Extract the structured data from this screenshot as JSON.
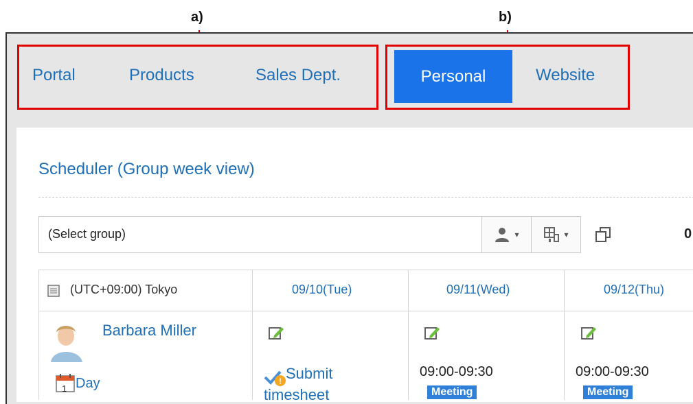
{
  "callouts": {
    "a": "a)",
    "b": "b)"
  },
  "tabs": {
    "left": [
      {
        "label": "Portal"
      },
      {
        "label": "Products"
      },
      {
        "label": "Sales Dept."
      }
    ],
    "right": [
      {
        "label": "Personal",
        "active": true
      },
      {
        "label": "Website"
      }
    ]
  },
  "scheduler": {
    "title": "Scheduler (Group week view)",
    "group_select": {
      "value": "(Select group)"
    },
    "count_fragment": "0",
    "timezone": "(UTC+09:00) Tokyo",
    "dates": [
      "09/10(Tue)",
      "09/11(Wed)",
      "09/12(Thu)"
    ],
    "user": {
      "name": "Barbara Miller",
      "day_link": "Day",
      "calendar_day": "1"
    },
    "events": {
      "col1_line1": "Submit",
      "col1_line2": "timesheet",
      "col2_time": "09:00-09:30",
      "col3_time": "09:00-09:30",
      "badge": "Meeting"
    }
  },
  "colors": {
    "accent": "#1a73e8",
    "link": "#1f6fb8",
    "callout_red": "#e00000",
    "frame_bg": "#e6e6e6"
  },
  "icons": [
    "user-icon",
    "facility-icon",
    "popup-window-icon",
    "calendar-icon",
    "edit-icon",
    "checkmark-icon",
    "warning-icon",
    "timezone-icon"
  ]
}
